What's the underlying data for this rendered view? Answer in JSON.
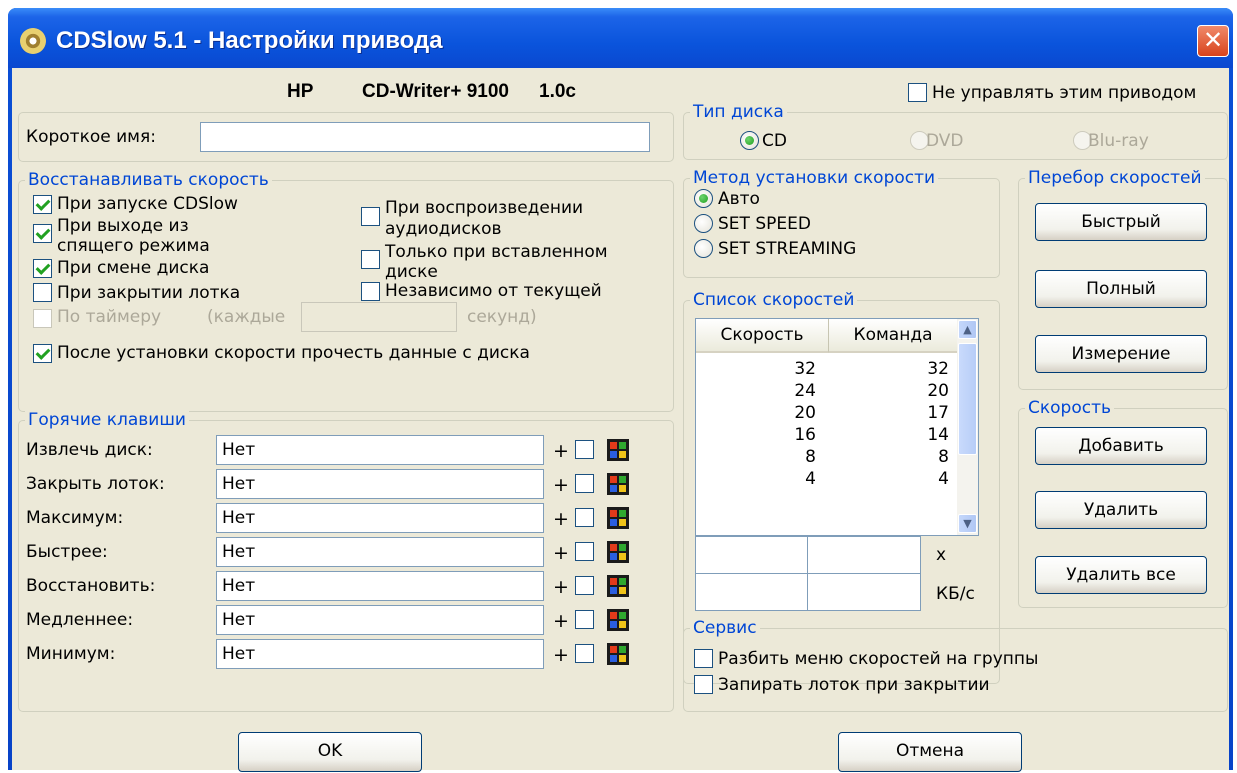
{
  "window": {
    "title": "CDSlow 5.1 - Настройки привода",
    "close": "✕"
  },
  "drive": {
    "vendor": "HP",
    "model": "CD-Writer+ 9100",
    "revision": "1.0c"
  },
  "dont_manage": {
    "label": "Не управлять этим приводом",
    "checked": false
  },
  "short_name": {
    "label": "Короткое имя:",
    "value": ""
  },
  "restore_speed": {
    "title": "Восстанавливать скорость",
    "on_start": "При запуске CDSlow",
    "on_wake_l1": "При выходе из",
    "on_wake_l2": "спящего режима",
    "on_disc_change": "При смене диска",
    "on_tray_close": "При закрытии лотка",
    "on_audio_l1": "При воспроизведении",
    "on_audio_l2": "аудиодисков",
    "only_inserted_l1": "Только при вставленном",
    "only_inserted_l2": "диске",
    "regardless": "Независимо от текущей",
    "timer_label": "По таймеру",
    "timer_every": "(каждые",
    "timer_value": "",
    "timer_seconds": "секунд)",
    "read_after": "После установки скорости прочесть данные с диска"
  },
  "disc_type": {
    "title": "Тип диска",
    "cd": "CD",
    "dvd": "DVD",
    "bluray": "Blu-ray"
  },
  "method": {
    "title": "Метод установки скорости",
    "auto": "Авто",
    "set_speed": "SET SPEED",
    "set_streaming": "SET STREAMING"
  },
  "speed_list": {
    "title": "Список скоростей",
    "col_speed": "Скорость",
    "col_command": "Команда",
    "rows": [
      {
        "speed": "32",
        "command": "32"
      },
      {
        "speed": "24",
        "command": "20"
      },
      {
        "speed": "20",
        "command": "17"
      },
      {
        "speed": "16",
        "command": "14"
      },
      {
        "speed": "8",
        "command": "8"
      },
      {
        "speed": "4",
        "command": "4"
      }
    ],
    "unit_x": "x",
    "unit_kbs": "КБ/с"
  },
  "speed_scan": {
    "title": "Перебор скоростей",
    "fast": "Быстрый",
    "full": "Полный",
    "measure": "Измерение"
  },
  "speed": {
    "title": "Скорость",
    "add": "Добавить",
    "remove": "Удалить",
    "remove_all": "Удалить все"
  },
  "hotkeys": {
    "title": "Горячие клавиши",
    "rows": [
      {
        "label": "Извлечь диск:",
        "value": "Нет"
      },
      {
        "label": "Закрыть лоток:",
        "value": "Нет"
      },
      {
        "label": "Максимум:",
        "value": "Нет"
      },
      {
        "label": "Быстрее:",
        "value": "Нет"
      },
      {
        "label": "Восстановить:",
        "value": "Нет"
      },
      {
        "label": "Медленнее:",
        "value": "Нет"
      },
      {
        "label": "Минимум:",
        "value": "Нет"
      }
    ],
    "plus": "+"
  },
  "service": {
    "title": "Сервис",
    "split_menu": "Разбить меню скоростей на группы",
    "lock_tray": "Запирать лоток при закрытии"
  },
  "buttons": {
    "ok": "OK",
    "cancel": "Отмена"
  },
  "colors": {
    "title_bar": "#0a54dc",
    "dialog_bg": "#ece9d8",
    "group_title": "#0046d5",
    "check": "#21a121"
  }
}
